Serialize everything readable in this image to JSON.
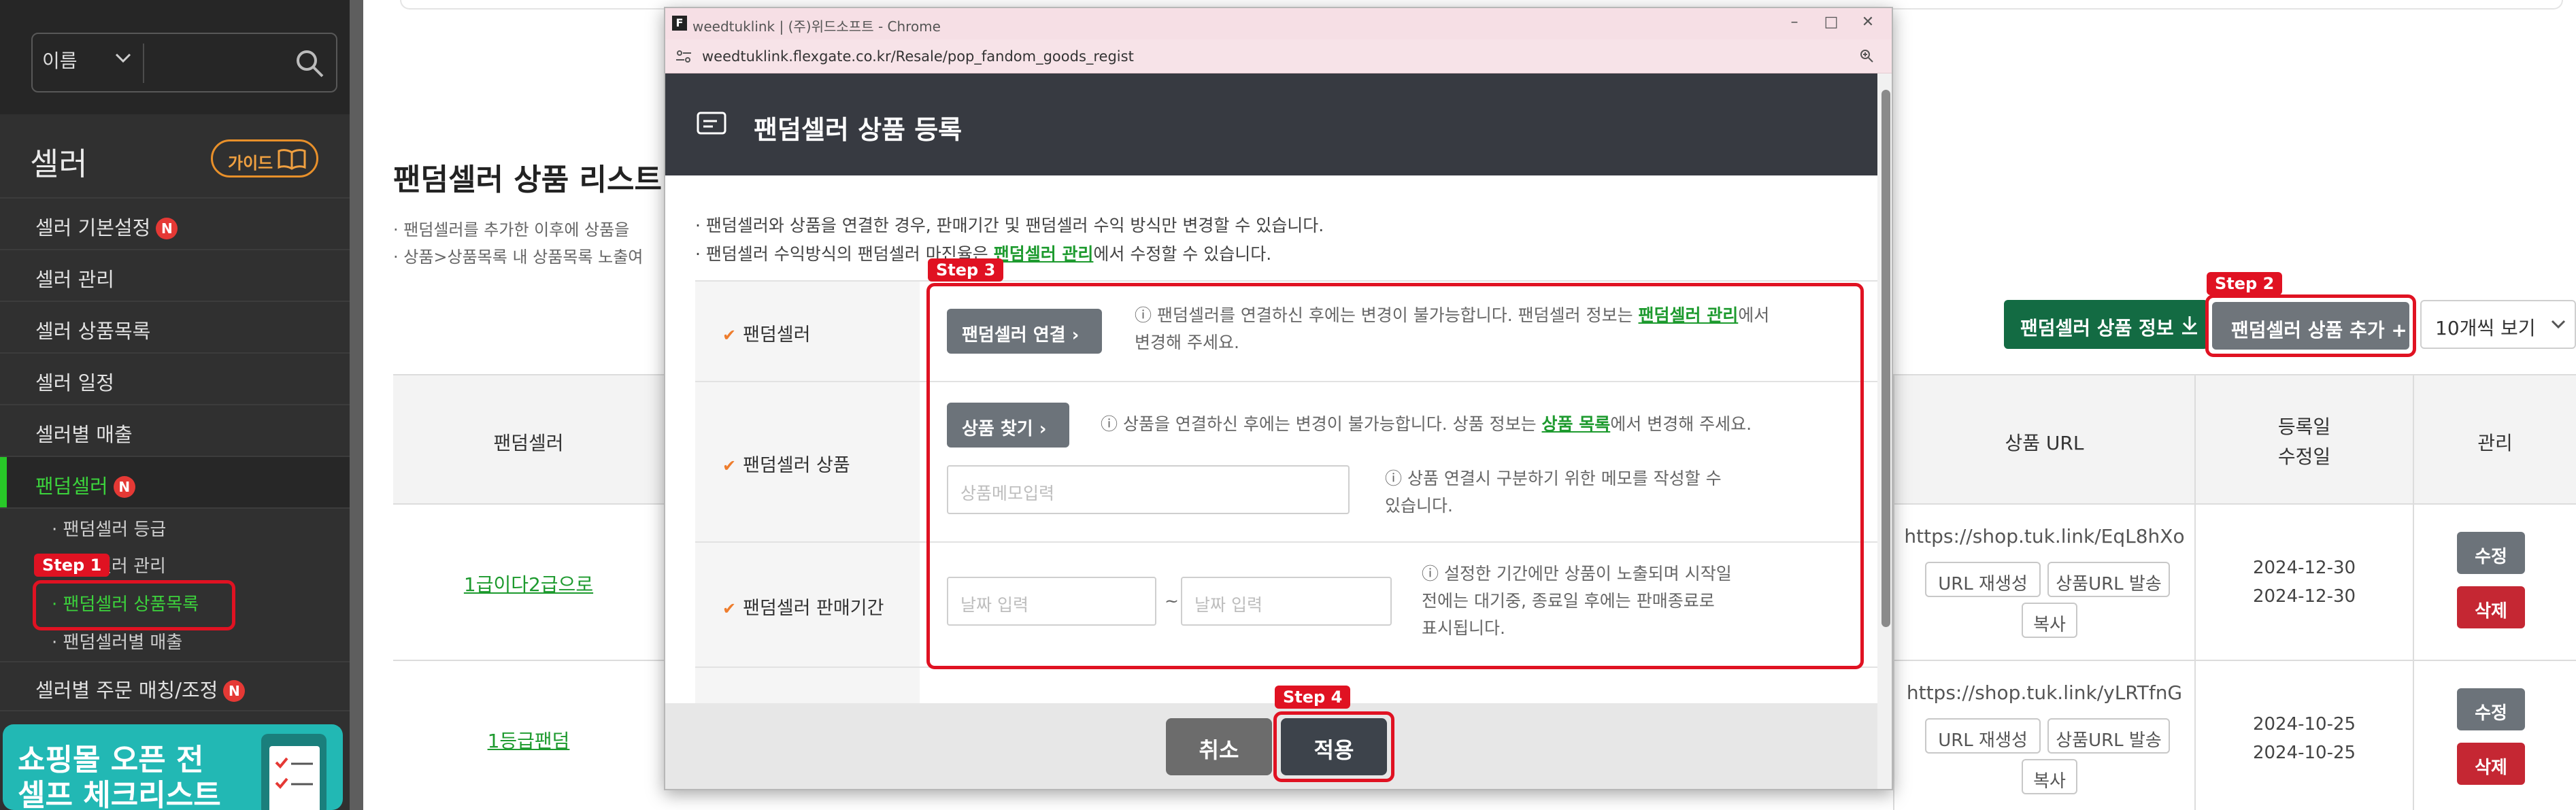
{
  "sidebar": {
    "search_type": "이름",
    "section_title": "셀러",
    "guide_label": "가이드",
    "items": [
      {
        "label": "셀러 기본설정",
        "badge": "N"
      },
      {
        "label": "셀러 관리"
      },
      {
        "label": "셀러 상품목록"
      },
      {
        "label": "셀러 일정"
      },
      {
        "label": "셀러별 매출"
      },
      {
        "label": "팬덤셀러",
        "badge": "N"
      }
    ],
    "sub_items": [
      {
        "label": "· 팬덤셀러 등급"
      },
      {
        "label": "셀러 관리"
      },
      {
        "label": "· 팬덤셀러 상품목록"
      },
      {
        "label": "· 팬덤셀러별 매출"
      }
    ],
    "last_item": {
      "label": "셀러별 주문 매칭/조정",
      "badge": "N"
    },
    "banner": {
      "line1": "쇼핑몰 오픈 전",
      "line2": "셀프 체크리스트"
    }
  },
  "steps": {
    "step1": "Step 1",
    "step2": "Step 2",
    "step3": "Step 3",
    "step4": "Step 4"
  },
  "main": {
    "title": "팬덤셀러 상품 리스트",
    "note1": "· 팬덤셀러를 추가한 이후에 상품을",
    "note2": "· 상품>상품목록 내 상품목록 노출여",
    "btn_info": "팬덤셀러 상품 정보",
    "btn_add": "팬덤셀러 상품 추가 +",
    "page_size": "10개씩 보기",
    "table": {
      "headers": {
        "seller": "팬덤셀러",
        "url": "상품 URL",
        "date1": "등록일",
        "date2": "수정일",
        "manage": "관리"
      },
      "rows": [
        {
          "seller": "1급이다2급으로",
          "url": "https://shop.tuk.link/EqL8hXo",
          "btn_regen": "URL 재생성",
          "btn_send": "상품URL 발송",
          "btn_copy": "복사",
          "reg": "2024-12-30",
          "mod": "2024-12-30",
          "edit": "수정",
          "del": "삭제"
        },
        {
          "seller": "1등급팬덤",
          "url": "https://shop.tuk.link/yLRTfnG",
          "btn_regen": "URL 재생성",
          "btn_send": "상품URL 발송",
          "btn_copy": "복사",
          "reg": "2024-10-25",
          "mod": "2024-10-25",
          "edit": "수정",
          "del": "삭제"
        }
      ]
    }
  },
  "popup": {
    "window_title": "weedtuklink | (주)위드소프트 - Chrome",
    "url": "weedtuklink.flexgate.co.kr/Resale/pop_fandom_goods_regist",
    "header_title": "팬덤셀러 상품 등록",
    "note1": "· 팬덤셀러와 상품을 연결한 경우, 판매기간 및 팬덤셀러 수익 방식만 변경할 수 있습니다.",
    "note2_pre": "· 팬덤셀러 수익방식의 팬덤셀러 마진율은 ",
    "note2_link": "팬덤셀러 관리",
    "note2_post": "에서 수정할 수 있습니다.",
    "labels": {
      "seller": "팬덤셀러",
      "product": "팬덤셀러 상품",
      "period": "팬덤셀러 판매기간"
    },
    "btn_connect": "팬덤셀러 연결 ›",
    "help_seller_pre": "ⓘ 팬덤셀러를 연결하신 후에는 변경이 불가능합니다. 팬덤셀러 정보는 ",
    "help_seller_link": "팬덤셀러 관리",
    "help_seller_post": "에서",
    "help_seller_line2": "변경해 주세요.",
    "btn_find": "상품 찾기 ›",
    "help_product_pre": "ⓘ 상품을 연결하신 후에는 변경이 불가능합니다. 상품 정보는 ",
    "help_product_link": "상품 목록",
    "help_product_post": "에서 변경해 주세요.",
    "memo_placeholder": "상품메모입력",
    "help_memo_l1": "ⓘ 상품 연결시 구분하기 위한 메모를 작성할 수",
    "help_memo_l2": "있습니다.",
    "date_placeholder": "날짜 입력",
    "tilde": "~",
    "help_period_l1": "ⓘ 설정한 기간에만 상품이 노출되며 시작일",
    "help_period_l2": "전에는 대기중, 종료일 후에는 판매종료로",
    "help_period_l3": "표시됩니다.",
    "btn_cancel": "취소",
    "btn_apply": "적용"
  },
  "colors": {
    "accent_green": "#1d9a2e",
    "step_red": "#e01222",
    "header_dark": "#373a41"
  }
}
